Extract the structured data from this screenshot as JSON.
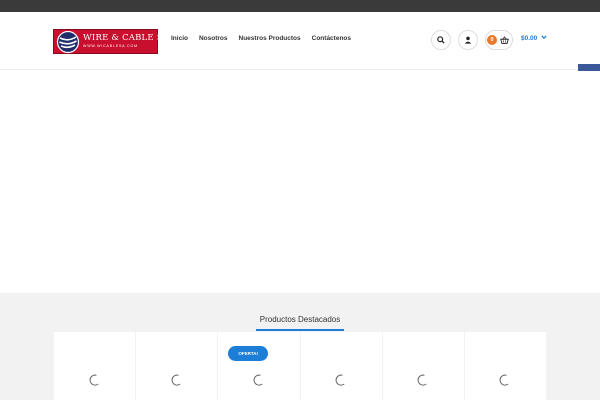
{
  "header": {
    "logo": {
      "name": "WIRE & CABLE S.A.",
      "url": "WWW.WICABLESA.COM"
    },
    "nav": [
      {
        "label": "Inicio"
      },
      {
        "label": "Nosotros"
      },
      {
        "label": "Nuestros Productos"
      },
      {
        "label": "Contáctenos"
      }
    ],
    "icons": {
      "search": "search-icon",
      "user": "user-icon",
      "cart": "basket-icon"
    },
    "cart": {
      "count": "0",
      "total": "$0.00"
    }
  },
  "social": [
    {
      "name": "facebook-icon",
      "color": "#3b5998"
    },
    {
      "name": "twitter-icon",
      "color": "#1da1f2"
    },
    {
      "name": "share-icon",
      "color": "#e8334a"
    }
  ],
  "featured": {
    "title": "Productos Destacados",
    "products": [
      {
        "badge": ""
      },
      {
        "badge": ""
      },
      {
        "badge": "OFERTA!"
      },
      {
        "badge": ""
      },
      {
        "badge": ""
      },
      {
        "badge": ""
      }
    ]
  },
  "colors": {
    "accent": "#1c7ed6",
    "brand": "#c8102e",
    "cart_badge": "#e8782a",
    "topbar": "#3a3a3a"
  }
}
